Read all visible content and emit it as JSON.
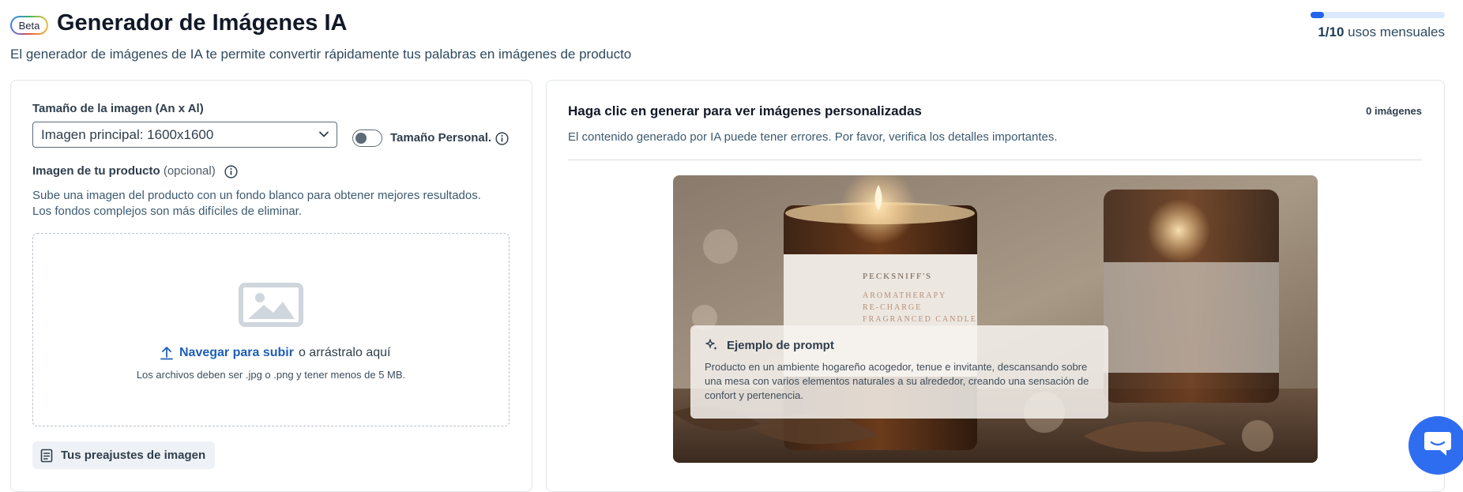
{
  "header": {
    "badge": "Beta",
    "title": "Generador de Imágenes IA",
    "subtitle": "El generador de imágenes de IA te permite convertir rápidamente tus palabras en imágenes de producto",
    "usage": {
      "used": "1/10",
      "label": "usos mensuales",
      "fraction": 0.1
    }
  },
  "left_panel": {
    "size_label": "Tamaño de la imagen (An x Al)",
    "size_select_value": "Imagen principal: 1600x1600",
    "custom_size_label": "Tamaño Personal.",
    "custom_size_enabled": false,
    "product_image_label": "Imagen de tu producto",
    "product_image_optional": "(opcional)",
    "help_text_1": "Sube una imagen del producto con un fondo blanco para obtener mejores resultados.",
    "help_text_2": "Los fondos complejos son más difíciles de eliminar.",
    "upload_link": "Navegar para subir",
    "upload_rest": "o arrástralo aquí",
    "file_note": "Los archivos deben ser .jpg o .png y tener menos de 5 MB.",
    "presets_button": "Tus preajustes de imagen"
  },
  "right_panel": {
    "title": "Haga clic en generar para ver imágenes personalizadas",
    "count": "0 imágenes",
    "note": "El contenido generado por IA puede tener errores. Por favor, verifica los detalles importantes.",
    "photo_brand": "PECKSNIFF'S",
    "photo_line_1": "AROMATHERAPY",
    "photo_line_2": "RE-CHARGE",
    "photo_line_3": "FRAGRANCED CANDLE",
    "prompt_title": "Ejemplo de prompt",
    "prompt_text": "Producto en un ambiente hogareño acogedor, tenue e invitante, descansando sobre una mesa con varios elementos naturales a su alrededor, creando una sensación de confort y pertenencia."
  },
  "colors": {
    "accent": "#2563eb",
    "link": "#1d5fb8",
    "chat_button": "#2f6df0"
  },
  "icons": [
    "info-icon",
    "chevron-down-icon",
    "image-placeholder-icon",
    "upload-icon",
    "presets-icon",
    "sparkle-icon",
    "chat-icon"
  ]
}
